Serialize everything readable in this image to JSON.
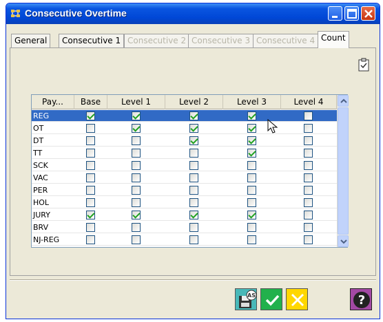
{
  "window": {
    "title": "Consecutive Overtime"
  },
  "tabs": [
    {
      "label": "General",
      "state": "enabled"
    },
    {
      "label": "Consecutive 1",
      "state": "enabled"
    },
    {
      "label": "Consecutive 2",
      "state": "disabled"
    },
    {
      "label": "Consecutive 3",
      "state": "disabled"
    },
    {
      "label": "Consecutive 4",
      "state": "disabled"
    },
    {
      "label": "Count",
      "state": "active"
    }
  ],
  "grid": {
    "columns": [
      "Pay...",
      "Base",
      "Level 1",
      "Level 2",
      "Level 3",
      "Level 4"
    ],
    "rows": [
      {
        "pay": "REG",
        "checks": [
          true,
          true,
          true,
          true,
          false
        ],
        "selected": true
      },
      {
        "pay": "OT",
        "checks": [
          false,
          true,
          true,
          true,
          false
        ]
      },
      {
        "pay": "DT",
        "checks": [
          false,
          false,
          true,
          true,
          false
        ]
      },
      {
        "pay": "TT",
        "checks": [
          false,
          false,
          false,
          true,
          false
        ]
      },
      {
        "pay": "SCK",
        "checks": [
          false,
          false,
          false,
          false,
          false
        ]
      },
      {
        "pay": "VAC",
        "checks": [
          false,
          false,
          false,
          false,
          false
        ]
      },
      {
        "pay": "PER",
        "checks": [
          false,
          false,
          false,
          false,
          false
        ]
      },
      {
        "pay": "HOL",
        "checks": [
          false,
          false,
          false,
          false,
          false
        ]
      },
      {
        "pay": "JURY",
        "checks": [
          true,
          true,
          true,
          true,
          false
        ]
      },
      {
        "pay": "BRV",
        "checks": [
          false,
          false,
          false,
          false,
          false
        ]
      },
      {
        "pay": "NJ-REG",
        "checks": [
          false,
          false,
          false,
          false,
          false
        ]
      }
    ]
  },
  "buttons": {
    "save_as": {
      "icon": "save-as-icon"
    },
    "ok": {
      "icon": "checkmark-icon"
    },
    "cancel": {
      "icon": "x-icon"
    },
    "help": {
      "icon": "question-icon"
    }
  },
  "colors": {
    "titlebar": "#0a55e0",
    "selection": "#316ac5",
    "check": "#21a121",
    "ok_button": "#22b14c",
    "cancel_button": "#ffd700",
    "help_button": "#a349a4"
  }
}
